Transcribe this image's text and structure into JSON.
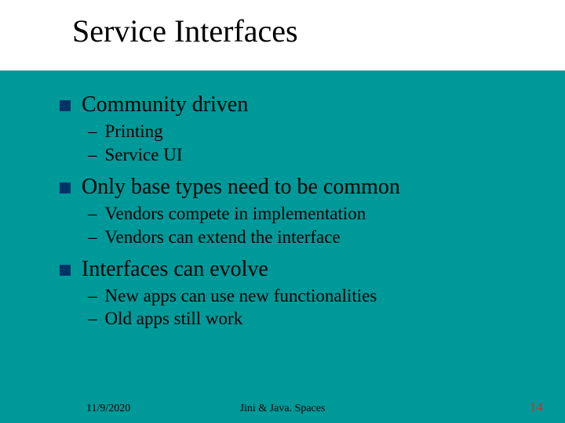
{
  "title": "Service Interfaces",
  "points": [
    {
      "text": "Community driven",
      "sub": [
        "Printing",
        "Service UI"
      ]
    },
    {
      "text": "Only base types need to be common",
      "sub": [
        "Vendors compete in implementation",
        "Vendors can extend the interface"
      ]
    },
    {
      "text": "Interfaces can evolve",
      "sub": [
        "New apps can use new functionalities",
        "Old apps still work"
      ]
    }
  ],
  "footer": {
    "date": "11/9/2020",
    "center": "Jini  &  Java. Spaces",
    "page": "14"
  }
}
